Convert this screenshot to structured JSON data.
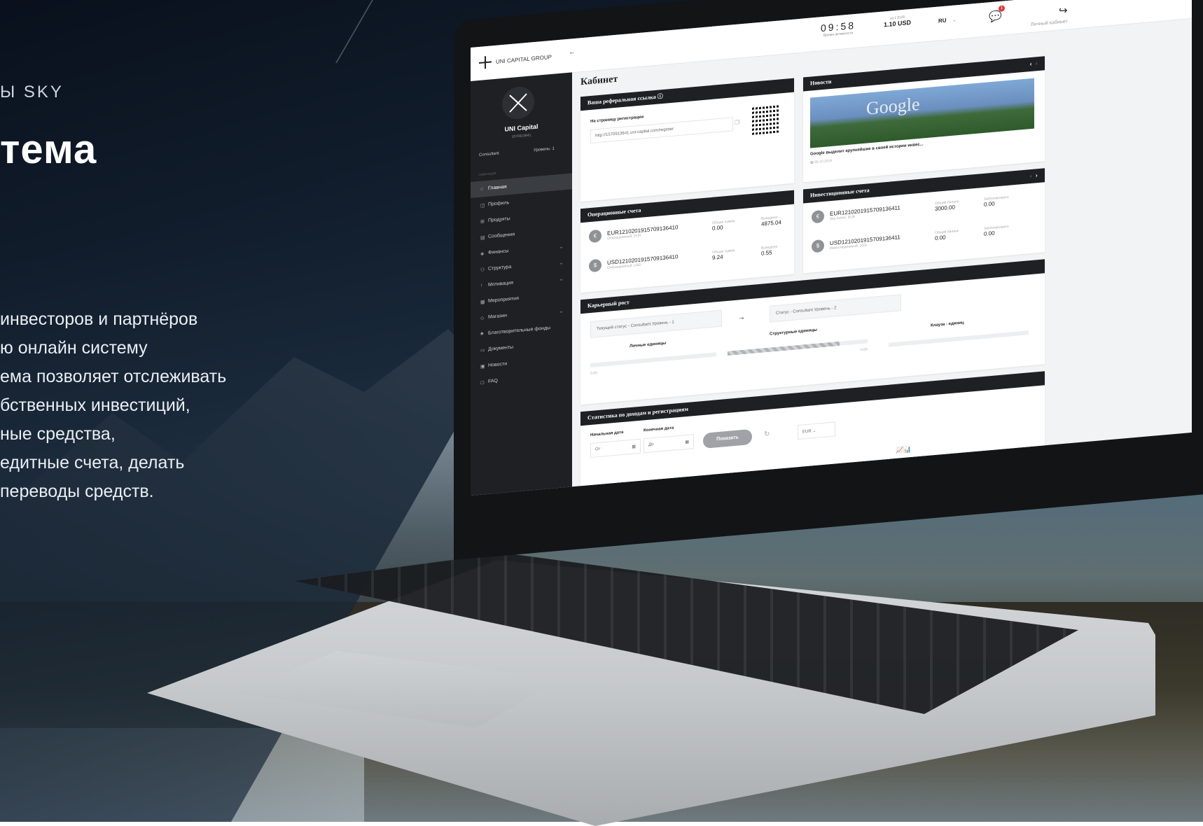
{
  "hero": {
    "kicker": "Ы SKY",
    "title": "тема",
    "body": [
      "инвесторов и партнёров",
      "ю онлайн систему",
      "ема позволяет отслеживать",
      "бственных инвестиций,",
      "ные средства,",
      "едитные счета, делать",
      "переводы средств."
    ]
  },
  "app": {
    "brand": "UNI CAPITAL GROUP",
    "clock": {
      "time": "09:58",
      "caption": "Время активности"
    },
    "rate": {
      "caption": "за 1 EUR",
      "value": "1.10 USD"
    },
    "lang": {
      "value": "RU",
      "chevron": "⌄"
    },
    "notifications": "1",
    "breadcrumb": "Личный кабинет",
    "user": {
      "name": "UNI Capital",
      "id": "1570913641",
      "role": "Consultant",
      "level": "Уровень: 1"
    },
    "section_label": "НАВИГАЦИЯ",
    "menu": [
      {
        "label": "Главная",
        "icon": "home-icon",
        "glyph": "⌂",
        "active": true
      },
      {
        "label": "Профиль",
        "icon": "profile-icon",
        "glyph": "◫"
      },
      {
        "label": "Продукты",
        "icon": "products-icon",
        "glyph": "⊞"
      },
      {
        "label": "Сообщения",
        "icon": "messages-icon",
        "glyph": "▤"
      },
      {
        "label": "Финансы",
        "icon": "finance-icon",
        "glyph": "◈",
        "expand": true
      },
      {
        "label": "Структура",
        "icon": "structure-icon",
        "glyph": "⚇",
        "expand": true
      },
      {
        "label": "Мотивация",
        "icon": "motivation-icon",
        "glyph": "↑",
        "expand": true
      },
      {
        "label": "Мероприятия",
        "icon": "events-icon",
        "glyph": "▦"
      },
      {
        "label": "Магазин",
        "icon": "shop-icon",
        "glyph": "◇",
        "expand": true
      },
      {
        "label": "Благотворительные фонды",
        "icon": "charity-icon",
        "glyph": "♣"
      },
      {
        "label": "Документы",
        "icon": "documents-icon",
        "glyph": "▭"
      },
      {
        "label": "Новости",
        "icon": "news-icon",
        "glyph": "▣"
      },
      {
        "label": "FAQ",
        "icon": "faq-icon",
        "glyph": "◻"
      }
    ],
    "page_title": "Кабинет",
    "referral": {
      "title": "Ваша реферальная ссылка",
      "label": "На страницу регистрации",
      "url": "http://1570913641.uni-capital.com/register"
    },
    "news": {
      "title": "Новости",
      "image_text": "Google",
      "headline": "Google выделит крупнейшие в своей истории инвес...",
      "date": "02.10.2019"
    },
    "operational": {
      "title": "Операционные счета",
      "accounts": [
        {
          "coin": "€",
          "number": "EUR1210201915709136410",
          "type": "Операционный, EUR",
          "l1": "Общая сумма",
          "v1": "0.00",
          "l2": "Выведено",
          "v2": "4875.04"
        },
        {
          "coin": "$",
          "number": "USD1210201915709136410",
          "type": "Операционный, USD",
          "l1": "Общая сумма",
          "v1": "9.24",
          "l2": "Выведено",
          "v2": "0.55"
        }
      ]
    },
    "investment": {
      "title": "Инвестиционные счета",
      "accounts": [
        {
          "coin": "€",
          "number": "EUR1210201915709136411",
          "type": "Sky Active, EUR",
          "l1": "Общий баланс",
          "v1": "3000.00",
          "l2": "Заблокировано",
          "v2": "0.00"
        },
        {
          "coin": "$",
          "number": "USD1210201915709136411",
          "type": "Инвестиционный, USD",
          "l1": "Общий баланс",
          "v1": "0.00",
          "l2": "Заблокировано",
          "v2": "0.00"
        }
      ]
    },
    "career": {
      "title": "Карьерный рост",
      "current": "Текущий статус - Consultant  Уровень - 1",
      "next": "Статус - Consultant  Уровень - 2",
      "personal": "Личные единицы",
      "structural": "Структурные единицы",
      "klauza": "Клауза - единиц",
      "personal_progress": 0.0,
      "structural_progress": 0.8,
      "klauza_progress": 0.0,
      "ticks": [
        "0.00",
        "0.00"
      ]
    },
    "stats": {
      "title": "Статистика по доходам и регистрациям",
      "start_label": "Начальная дата",
      "end_label": "Конечная дата",
      "start_placeholder": "От",
      "end_placeholder": "До",
      "show_button": "Показать",
      "currency": "EUR"
    }
  }
}
